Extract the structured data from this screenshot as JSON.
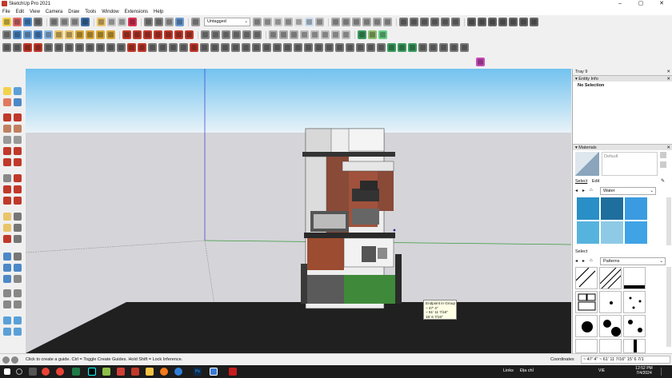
{
  "window": {
    "title": "SketchUp Pro 2021",
    "controls": [
      "–",
      "▢",
      "✕"
    ]
  },
  "menu": [
    "File",
    "Edit",
    "View",
    "Camera",
    "Draw",
    "Tools",
    "Window",
    "Extensions",
    "Help"
  ],
  "toolbar": {
    "tag_select": "Untagged"
  },
  "tooltip": {
    "lines": [
      "Endpoint in Group",
      "~ 47' 4\"",
      "~ 61' 11 7/16\"",
      "15' 6 7/16\""
    ]
  },
  "tray": {
    "title": "Tray 9",
    "entity_info": {
      "header": "Entity Info",
      "selection": "No Selection"
    },
    "materials": {
      "header": "Materials",
      "material_name": "Default",
      "tabs": [
        "Select",
        "Edit"
      ],
      "collection": "Water",
      "secondary_select": "Select",
      "secondary_collection": "Patterns",
      "water_colors": [
        "#2a8fc7",
        "#1f6f9e",
        "#3b9be0",
        "#56b3de",
        "#2e86c1",
        "#3fa3e6"
      ]
    }
  },
  "status": {
    "message": "Click to create a guide. Ctrl = Toggle Create Guides. Hold Shift = Lock Inference.",
    "coord_label": "Coordinates",
    "coord_value": "~ 47' 4\" ~ 61' 11 7/16\" 15' 6 7/1"
  },
  "taskbar": {
    "links": "Links",
    "address": "Địa chỉ",
    "lang": "VIE",
    "time": "12:52 PM",
    "date": "7/4/2024",
    "app_icons": [
      "start-icon",
      "search-icon",
      "taskview-icon",
      "chrome-icon",
      "excel-icon",
      "tiktok-icon",
      "mail-icon",
      "sketchup-icon",
      "explorer-icon",
      "firefox-icon",
      "edge-icon",
      "photoshop-icon",
      "vscode-icon",
      "sketchup-active-icon",
      "autocad-icon"
    ]
  }
}
